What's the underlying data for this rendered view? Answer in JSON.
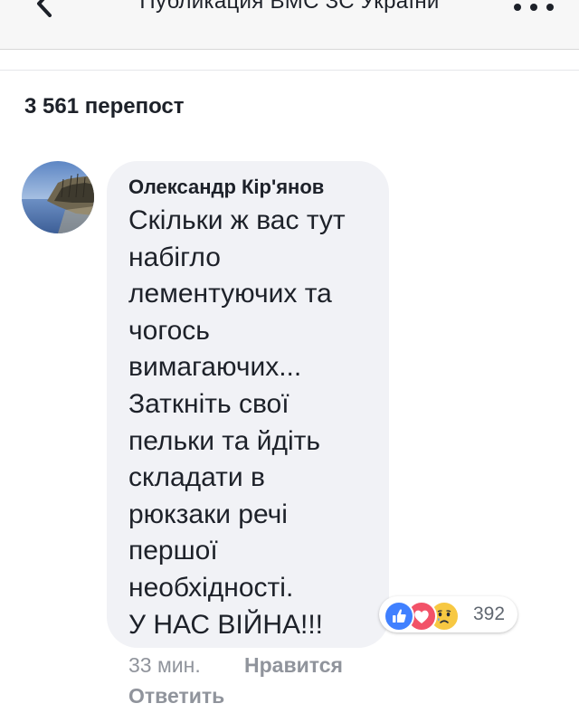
{
  "header": {
    "title": "Публикация ВМС ЗС України",
    "back_icon": "chevron-left-icon",
    "more_icon": "more-dots-icon"
  },
  "post": {
    "shares_label": "3 561 перепост"
  },
  "comment": {
    "author": "Олександр Кір'янов",
    "text_lines": [
      "Скільки ж вас тут",
      "набігло",
      "лементуючих та",
      "чогось",
      "вимагаючих...",
      "Заткніть свої",
      "пельки та йдіть",
      "складати в",
      "рюкзаки речі",
      "першої",
      "необхідності.",
      "У НАС ВІЙНА!!!"
    ],
    "time": "33 мин.",
    "like_label": "Нравится",
    "reply_label": "Ответить",
    "reactions": {
      "icons": [
        "like-icon",
        "love-icon",
        "sad-icon"
      ],
      "count": "392"
    }
  },
  "colors": {
    "text": "#1d2129",
    "muted": "#90949c",
    "bubble": "#f1f2f6",
    "header_bg": "#f7f7f7",
    "like": "#4080ff",
    "love": "#f25268",
    "sad": "#f7c842"
  }
}
